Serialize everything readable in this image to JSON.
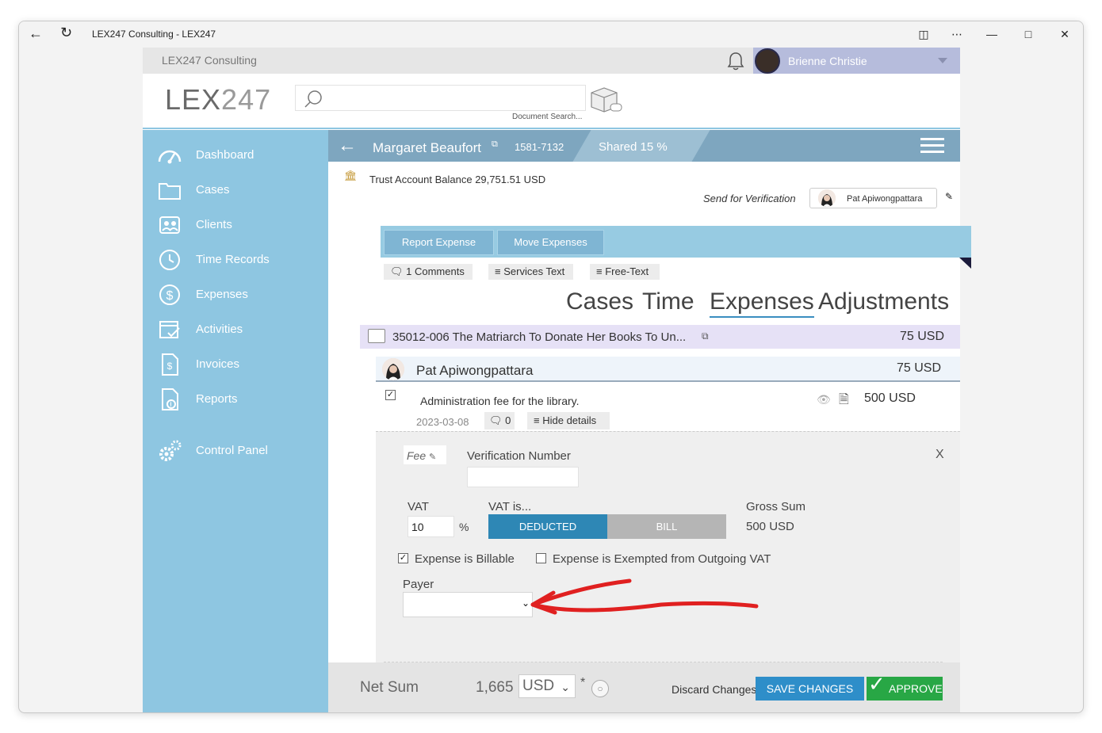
{
  "window": {
    "title": "LEX247 Consulting - LEX247"
  },
  "topbar": {
    "firm_name": "LEX247 Consulting",
    "user_name": "Brienne Christie"
  },
  "header": {
    "logo_main": "LEX",
    "logo_light": "247",
    "search_placeholder": "",
    "search_caption": "Document Search..."
  },
  "sidebar": {
    "items": [
      {
        "label": "Dashboard",
        "icon": "dashboard-icon"
      },
      {
        "label": "Cases",
        "icon": "folder-icon"
      },
      {
        "label": "Clients",
        "icon": "clients-icon"
      },
      {
        "label": "Time Records",
        "icon": "clock-icon"
      },
      {
        "label": "Expenses",
        "icon": "dollar-icon"
      },
      {
        "label": "Activities",
        "icon": "calendar-icon"
      },
      {
        "label": "Invoices",
        "icon": "invoice-icon"
      },
      {
        "label": "Reports",
        "icon": "report-icon"
      },
      {
        "label": "Control Panel",
        "icon": "gears-icon"
      }
    ]
  },
  "casebar": {
    "client": "Margaret Beaufort",
    "case_number": "1581-7132",
    "shared": "Shared 15 %"
  },
  "trust": {
    "text": "Trust Account Balance 29,751.51 USD"
  },
  "verification": {
    "label": "Send for Verification",
    "person": "Pat Apiwongpattara"
  },
  "actions": {
    "report_expense": "Report Expense",
    "move_expenses": "Move Expenses"
  },
  "chips": {
    "comments": "1 Comments",
    "services_text": "Services Text",
    "free_text": "Free-Text"
  },
  "tabs": [
    "Cases",
    "Time",
    "Expenses",
    "Adjustments"
  ],
  "case_row": {
    "title": "35012-006 The Matriarch To Donate Her Books To Un...",
    "amount": "75 USD"
  },
  "person_row": {
    "name": "Pat Apiwongpattara",
    "amount": "75 USD"
  },
  "expense": {
    "description": "Administration fee for the library.",
    "amount": "500 USD",
    "date": "2023-03-08",
    "comment_count": "0",
    "hide_details": "Hide details"
  },
  "details": {
    "fee_label": "Fee",
    "verification_number_label": "Verification Number",
    "verification_number_value": "",
    "close": "X",
    "vat_label": "VAT",
    "vat_value": "10",
    "vat_unit": "%",
    "vat_is_label": "VAT is...",
    "deducted": "DEDUCTED",
    "bill": "BILL",
    "gross_sum_label": "Gross Sum",
    "gross_sum_value": "500 USD",
    "billable_label": "Expense is Billable",
    "billable_checked": true,
    "exempt_label": "Expense is Exempted from Outgoing VAT",
    "exempt_checked": false,
    "payer_label": "Payer",
    "payer_value": ""
  },
  "footer": {
    "net_sum_label": "Net Sum",
    "net_sum_value": "1,665",
    "currency": "USD",
    "asterisk": "*",
    "discard": "Discard Changes",
    "save": "SAVE CHANGES",
    "approve": "APPROVE"
  },
  "colors": {
    "sidebar": "#8ec6e1",
    "casebar": "#7ea6bf",
    "deducted_active": "#2e87b5",
    "bill_inactive": "#b5b5b5",
    "save": "#2e8ec9",
    "approve": "#28a745",
    "annotation_arrow": "#e02020"
  }
}
